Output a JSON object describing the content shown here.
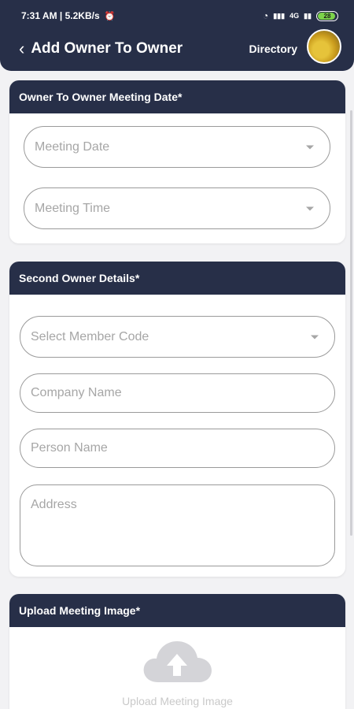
{
  "status_bar": {
    "time": "7:31 AM | 5.2KB/s",
    "network": "4G",
    "battery": "28"
  },
  "header": {
    "back_icon": "chevron-left-icon",
    "title": "Add Owner To Owner",
    "directory_label": "Directory"
  },
  "meeting_card": {
    "heading": "Owner To Owner Meeting Date*",
    "date_placeholder": "Meeting Date",
    "time_placeholder": "Meeting Time"
  },
  "owner_card": {
    "heading": "Second Owner Details*",
    "member_code_placeholder": "Select Member Code",
    "company_placeholder": "Company Name",
    "person_placeholder": "Person Name",
    "address_placeholder": "Address"
  },
  "upload_card": {
    "heading": "Upload Meeting Image*",
    "upload_label": "Upload Meeting Image",
    "upload_icon": "cloud-upload-icon"
  },
  "colors": {
    "primary": "#272f48",
    "background": "#f2f2f4",
    "placeholder": "#a6a6a6"
  }
}
